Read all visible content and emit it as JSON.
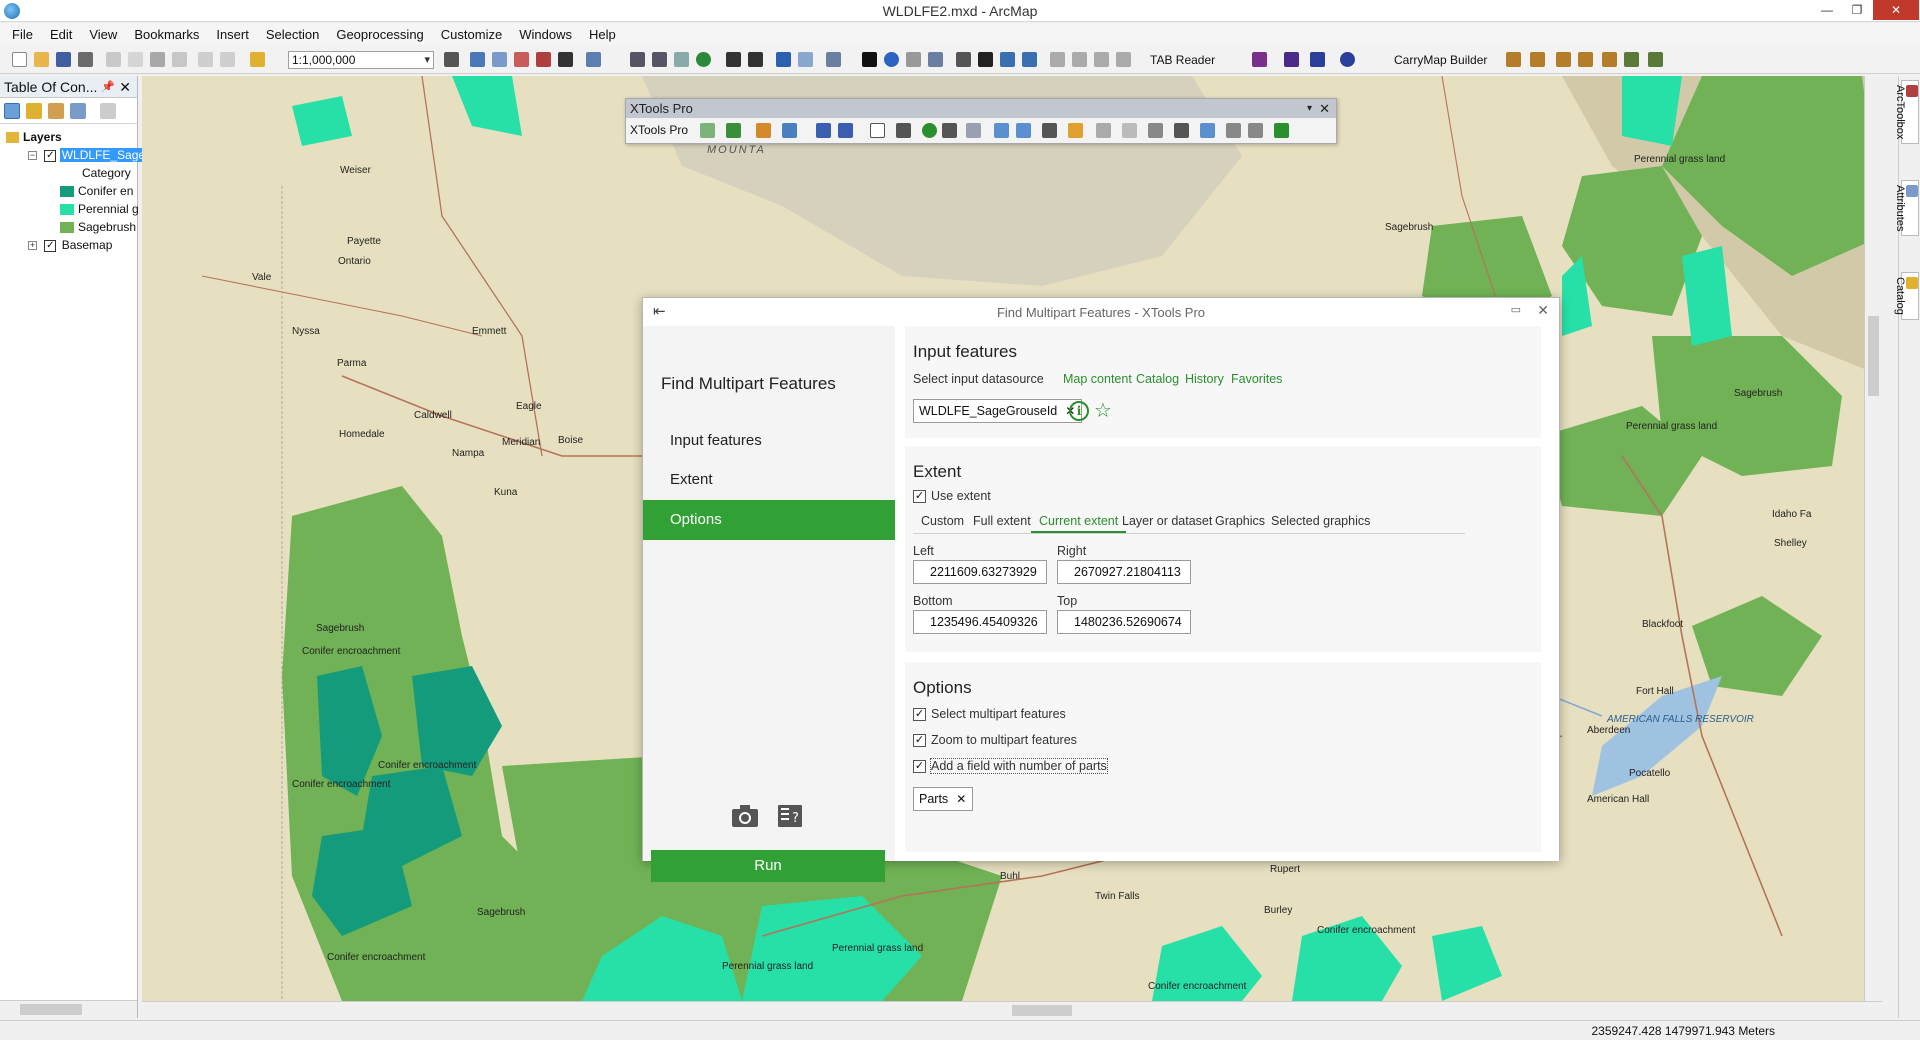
{
  "window": {
    "title": "WLDLFE2.mxd - ArcMap"
  },
  "menu": [
    "File",
    "Edit",
    "View",
    "Bookmarks",
    "Insert",
    "Selection",
    "Geoprocessing",
    "Customize",
    "Windows",
    "Help"
  ],
  "toolbar": {
    "scale": "1:1,000,000",
    "tab_reader": "TAB Reader",
    "carrymap": "CarryMap Builder"
  },
  "toc": {
    "title": "Table Of Con...",
    "root": "Layers",
    "layer": "WLDLFE_Sage",
    "category": "Category",
    "legend": [
      {
        "label": "Conifer en",
        "color": "#139b7b"
      },
      {
        "label": "Perennial g",
        "color": "#26e0a7"
      },
      {
        "label": "Sagebrush",
        "color": "#70b255"
      }
    ],
    "basemap": "Basemap"
  },
  "xtools": {
    "title": "XTools Pro",
    "label": "XTools Pro"
  },
  "dialog": {
    "title": "Find Multipart Features - XTools Pro",
    "heading": "Find Multipart Features",
    "nav": [
      "Input features",
      "Extent",
      "Options"
    ],
    "run": "Run",
    "input": {
      "title": "Input features",
      "select_label": "Select input datasource",
      "links": [
        "Map content",
        "Catalog",
        "History",
        "Favorites"
      ],
      "selected": "WLDLFE_SageGrouseId"
    },
    "extent": {
      "title": "Extent",
      "use_extent": "Use extent",
      "tabs": [
        "Custom",
        "Full extent",
        "Current extent",
        "Layer or dataset",
        "Graphics",
        "Selected graphics"
      ],
      "left_label": "Left",
      "left": "2211609.63273929",
      "right_label": "Right",
      "right": "2670927.21804113",
      "bottom_label": "Bottom",
      "bottom": "1235496.45409326",
      "top_label": "Top",
      "top": "1480236.52690674"
    },
    "options": {
      "title": "Options",
      "opt1": "Select multipart features",
      "opt2": "Zoom to multipart features",
      "opt3": "Add a field with number of parts",
      "field": "Parts"
    }
  },
  "map_labels": {
    "weiser": "Weiser",
    "payette": "Payette",
    "ontario": "Ontario",
    "vale": "Vale",
    "nyssa": "Nyssa",
    "parma": "Parma",
    "emmett": "Emmett",
    "caldwell": "Caldwell",
    "eagle": "Eagle",
    "homedale": "Homedale",
    "nampa": "Nampa",
    "meridian": "Meridian",
    "boise": "Boise",
    "kuna": "Kuna",
    "buhl": "Buhl",
    "twinfalls": "Twin Falls",
    "rupert": "Rupert",
    "burley": "Burley",
    "pocatello": "Pocatello",
    "blackfoot": "Blackfoot",
    "forthall": "Fort Hall",
    "aberdeen": "Aberdeen",
    "americanhall": "American Hall",
    "idahofalls": "Idaho Fa",
    "shelley": "Shelley",
    "sage1": "Sagebrush",
    "sage2": "Sagebrush",
    "sage3": "Sagebrush",
    "sage4": "Sagebrush",
    "pg1": "Perennial grass land",
    "pg2": "Perennial grass land",
    "pg3": "Perennial grass land",
    "pg4": "Perennial grass land",
    "ce1": "Conifer encroachment",
    "ce2": "Conifer encroachment",
    "ce3": "Conifer encroachment",
    "ce4": "Conifer encroachment",
    "ce5": "Conifer encroachment",
    "ce6": "Conifer encroachment",
    "reservoir": "AMERICAN FALLS RESERVOIR",
    "mountains": "MOUNTA"
  },
  "status": {
    "coords": "2359247.428  1479971.943 Meters"
  },
  "dock": [
    "ArcToolbox",
    "Attributes",
    "Catalog"
  ]
}
